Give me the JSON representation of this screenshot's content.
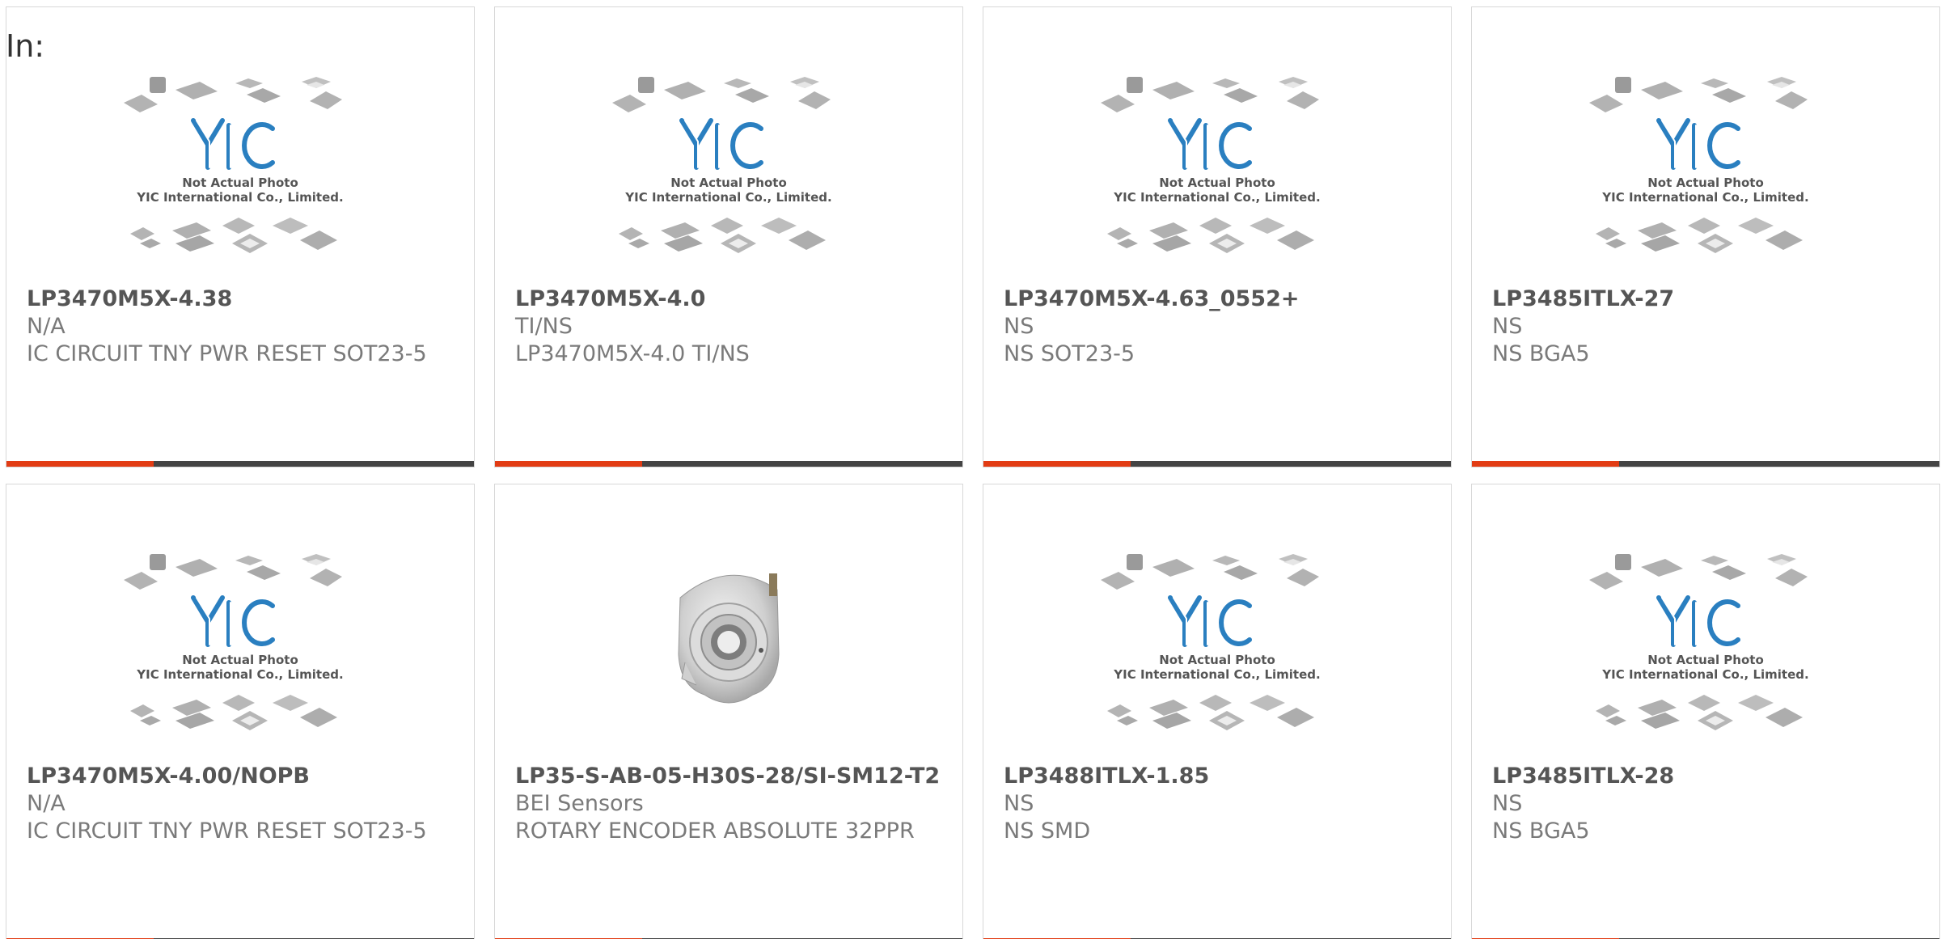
{
  "header": {
    "label": "In:"
  },
  "colors": {
    "accent": "#e23c14",
    "bar": "#444444",
    "logo": "#2a7fc0"
  },
  "placeholder": {
    "line1": "Not Actual Photo",
    "line2": "YIC International Co., Limited."
  },
  "products": [
    {
      "part": "LP3470M5X-4.38",
      "manufacturer": "N/A",
      "desc": "IC CIRCUIT TNY PWR RESET SOT23-5",
      "image": "placeholder"
    },
    {
      "part": "LP3470M5X-4.0",
      "manufacturer": "TI/NS",
      "desc": "LP3470M5X-4.0 TI/NS",
      "image": "placeholder"
    },
    {
      "part": "LP3470M5X-4.63_0552+",
      "manufacturer": "NS",
      "desc": "NS SOT23-5",
      "image": "placeholder"
    },
    {
      "part": "LP3485ITLX-27",
      "manufacturer": "NS",
      "desc": "NS BGA5",
      "image": "placeholder"
    },
    {
      "part": "LP3470M5X-4.00/NOPB",
      "manufacturer": "N/A",
      "desc": "IC CIRCUIT TNY PWR RESET SOT23-5",
      "image": "placeholder"
    },
    {
      "part": "LP35-S-AB-05-H30S-28/SI-SM12-T2",
      "manufacturer": "BEI Sensors",
      "desc": "ROTARY ENCODER ABSOLUTE 32PPR",
      "image": "encoder-photo"
    },
    {
      "part": "LP3488ITLX-1.85",
      "manufacturer": "NS",
      "desc": "NS SMD",
      "image": "placeholder"
    },
    {
      "part": "LP3485ITLX-28",
      "manufacturer": "NS",
      "desc": "NS BGA5",
      "image": "placeholder"
    }
  ]
}
